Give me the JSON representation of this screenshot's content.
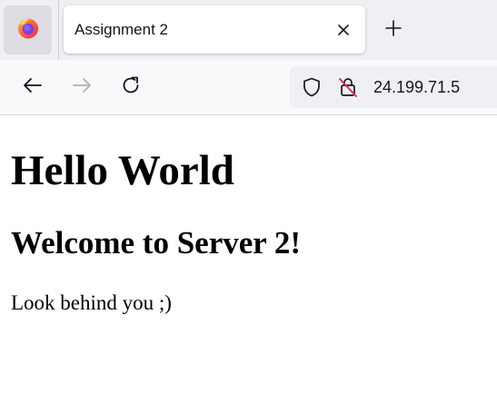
{
  "tab": {
    "title": "Assignment 2"
  },
  "urlbar": {
    "url": "24.199.71.5"
  },
  "page": {
    "heading": "Hello World",
    "subheading": "Welcome to Server 2!",
    "paragraph": "Look behind you ;)"
  },
  "icons": {
    "app_menu": "firefox-logo-icon",
    "tab_close": "close-icon",
    "new_tab": "plus-icon",
    "back": "arrow-left-icon",
    "forward": "arrow-right-icon",
    "reload": "reload-icon",
    "tracking_protection": "shield-icon",
    "connection": "lock-insecure-icon"
  },
  "colors": {
    "tabstrip": "#f0f0f4",
    "toolbar": "#f9f9fb",
    "insecure_slash": "#e22850"
  }
}
